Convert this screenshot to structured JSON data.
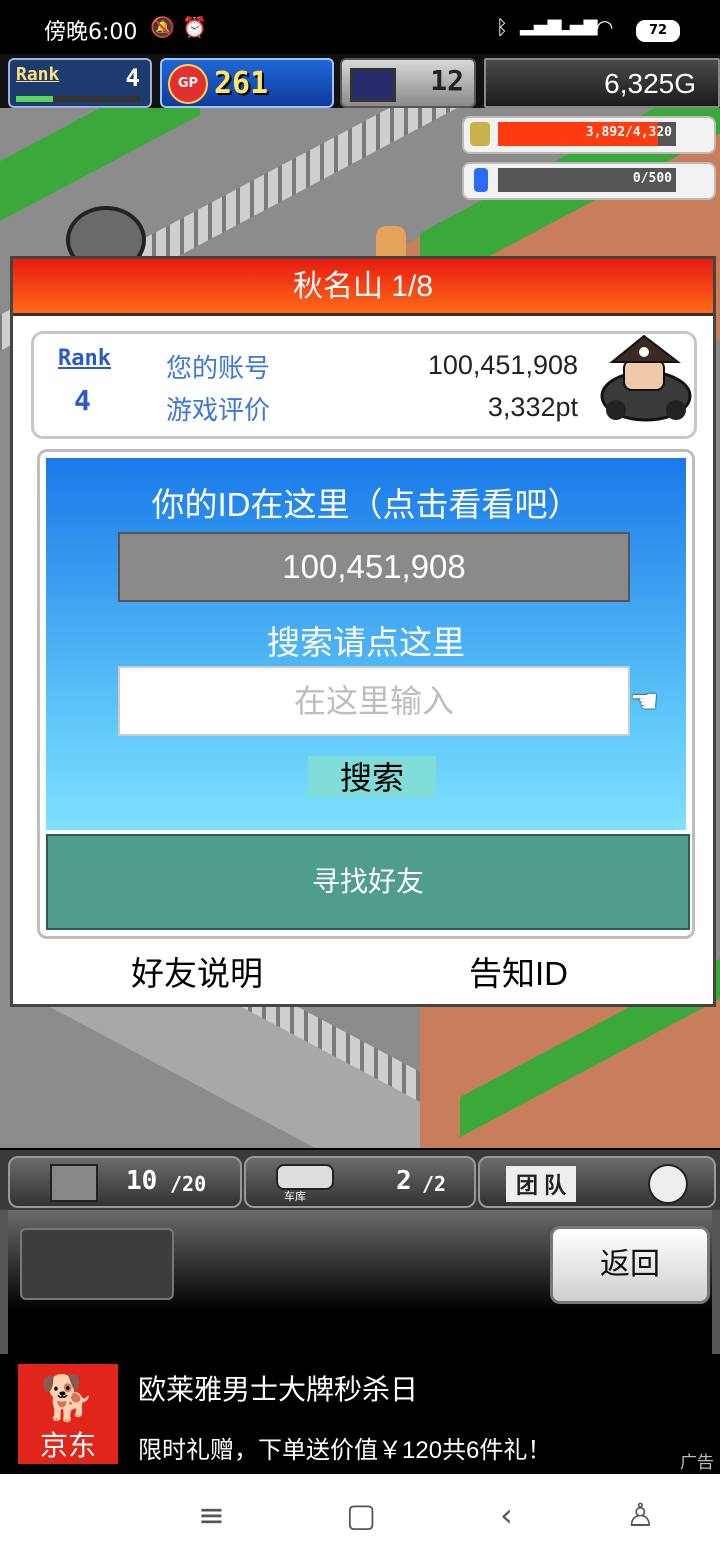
{
  "status_bar": {
    "time": "傍晚6:00",
    "icons": [
      "mute-icon",
      "alarm-icon",
      "bluetooth-icon",
      "signal-hd-icon",
      "signal-icon",
      "wifi-icon"
    ],
    "battery": "72"
  },
  "hud": {
    "rank_label": "Rank",
    "rank_value": "4",
    "rank_progress": 0.3,
    "gp_icon_label": "GP",
    "gp_value": "261",
    "pc_value": "12",
    "money": "6,325G"
  },
  "meters": [
    {
      "text": "3,892/4,320",
      "fill": 0.9,
      "color": "#ff3b0f"
    },
    {
      "text": "0/500",
      "fill": 0.0,
      "color": "#3b78ff"
    }
  ],
  "dialog": {
    "title": "秋名山 1/8",
    "rank_label": "Rank",
    "rank_value": "4",
    "account_label": "您的账号",
    "account_value": "100,451,908",
    "rating_label": "游戏评价",
    "rating_value": "3,332pt",
    "id_heading": "你的ID在这里（点击看看吧）",
    "id_value": "100,451,908",
    "search_heading": "搜索请点这里",
    "search_placeholder": "在这里输入",
    "search_button": "搜索",
    "find_friends": "寻找好友",
    "friend_help": "好友说明",
    "tell_id": "告知ID"
  },
  "bottom_bar": {
    "items_count": "10",
    "items_max": "/20",
    "garage_label": "车库",
    "garage_count": "2",
    "garage_max": "/2",
    "team_label": "团 队"
  },
  "back_button": "返回",
  "ad": {
    "brand": "京东",
    "title": "欧莱雅男士大牌秒杀日",
    "subtitle": "限时礼赠，下单送价值￥120共6件礼！",
    "tag": "广告"
  },
  "navbar": {
    "icons": [
      "menu-icon",
      "home-icon",
      "back-icon",
      "accessibility-icon"
    ]
  }
}
